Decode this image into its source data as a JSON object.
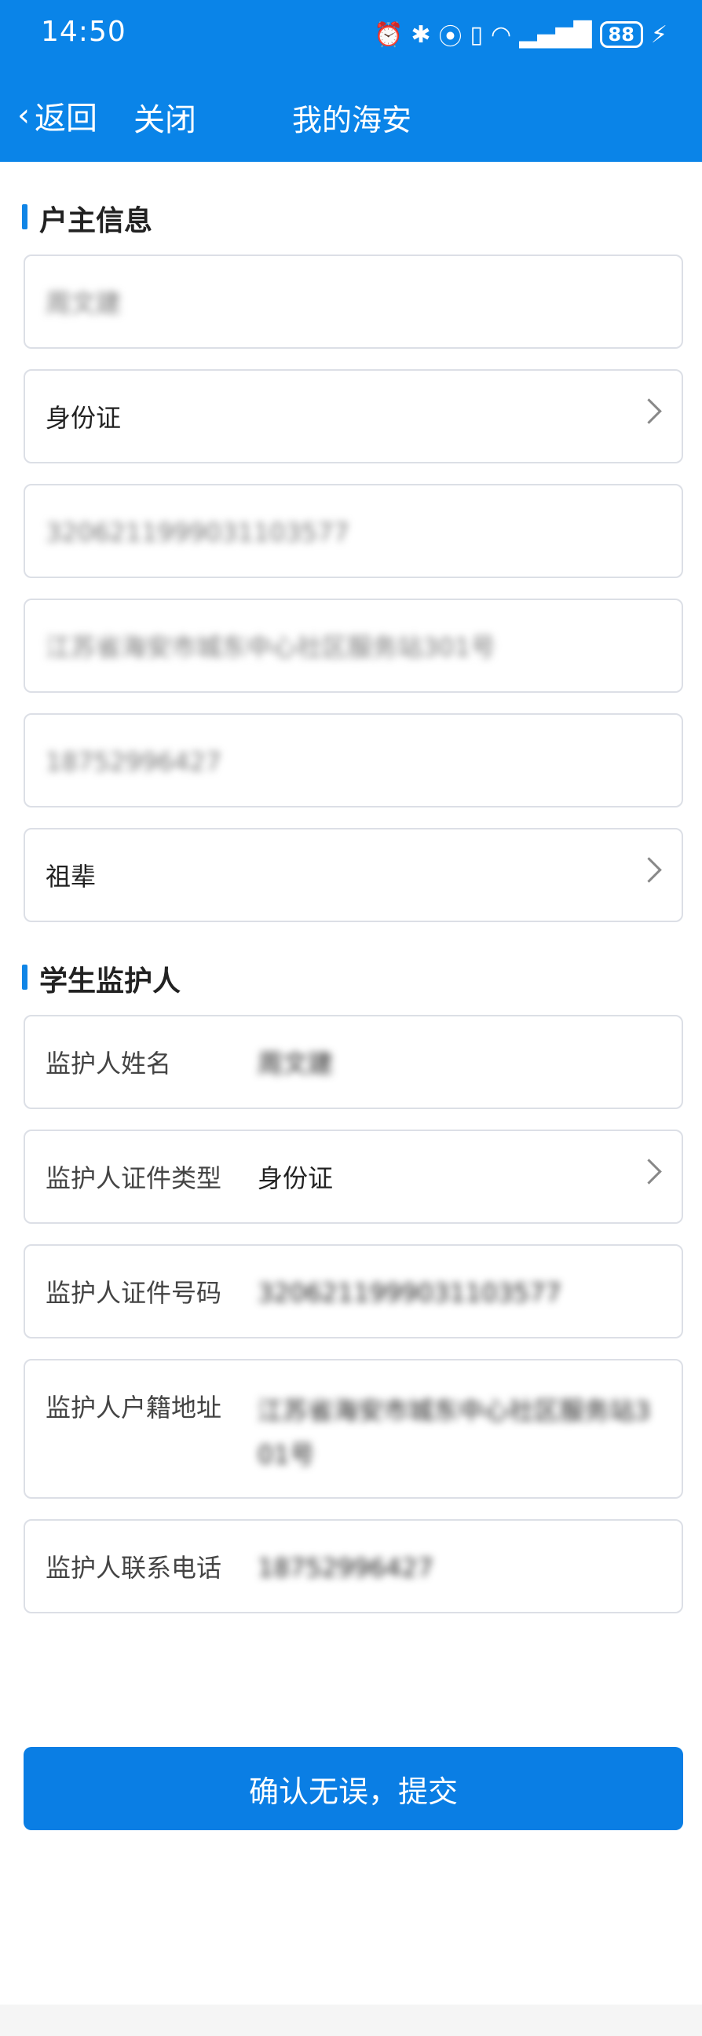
{
  "status_bar": {
    "time": "14:50",
    "battery": "88"
  },
  "nav": {
    "back_label": "返回",
    "close_label": "关闭",
    "title": "我的海安"
  },
  "householder": {
    "section_title": "户主信息",
    "name": "周文建",
    "id_type": "身份证",
    "id_number": "3206211999031103577",
    "address": "江苏省海安市城东中心社区服务站301号",
    "phone": "18752996427",
    "relation": "祖辈"
  },
  "guardian": {
    "section_title": "学生监护人",
    "name_label": "监护人姓名",
    "name_value": "周文建",
    "id_type_label": "监护人证件类型",
    "id_type_value": "身份证",
    "id_number_label": "监护人证件号码",
    "id_number_value": "3206211999031103577",
    "address_label": "监护人户籍地址",
    "address_value": "江苏省海安市城东中心社区服务站301号",
    "phone_label": "监护人联系电话",
    "phone_value": "18752996427"
  },
  "submit_label": "确认无误，提交",
  "colors": {
    "accent": "#0a84e8",
    "border": "#dcdfe6"
  }
}
